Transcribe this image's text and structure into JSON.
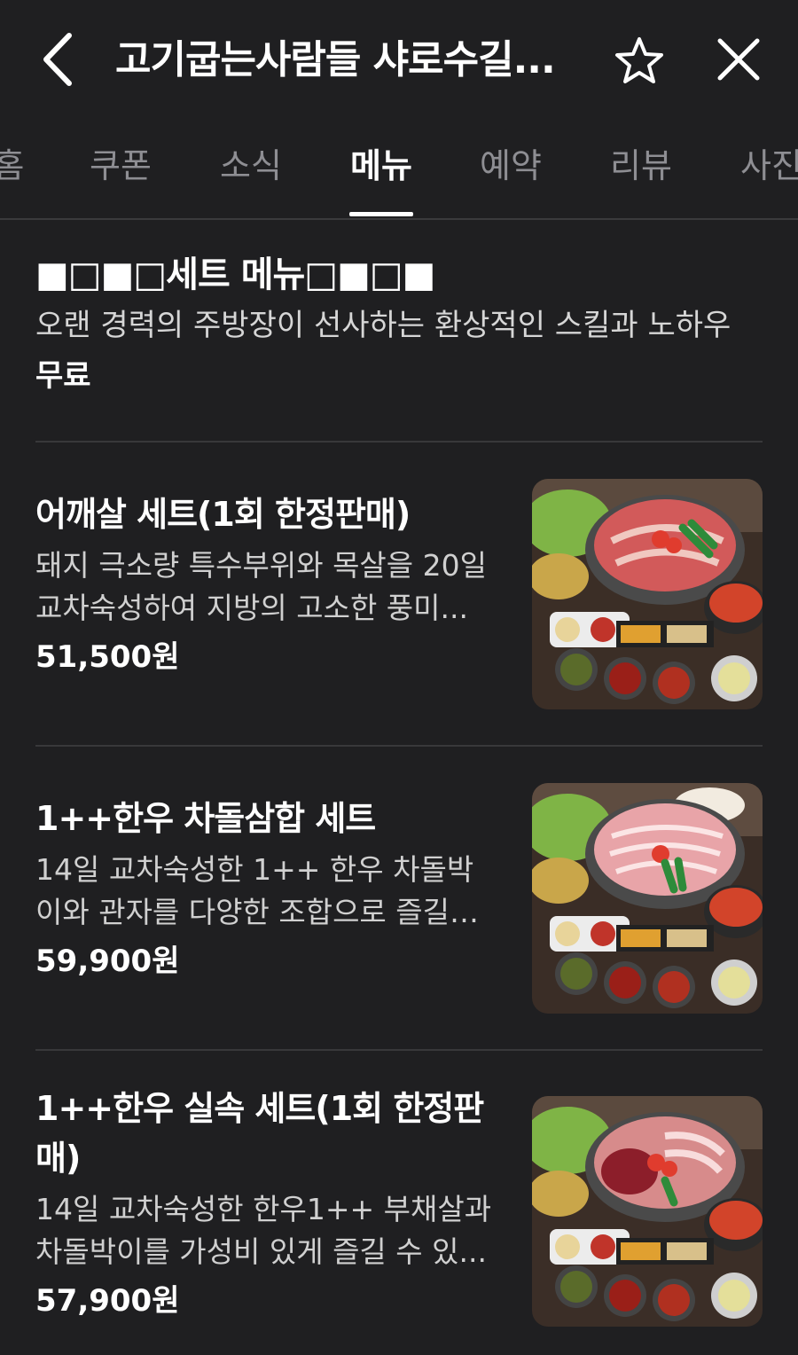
{
  "header": {
    "title": "고기굽는사람들 샤로수길...",
    "back_icon": "chevron-left-icon",
    "favorite_icon": "star-outline-icon",
    "close_icon": "close-icon"
  },
  "tabs": [
    {
      "label": "홈",
      "active": false
    },
    {
      "label": "쿠폰",
      "active": false
    },
    {
      "label": "소식",
      "active": false
    },
    {
      "label": "메뉴",
      "active": true
    },
    {
      "label": "예약",
      "active": false
    },
    {
      "label": "리뷰",
      "active": false
    },
    {
      "label": "사진",
      "active": false
    }
  ],
  "notice": {
    "title": "■□■□세트 메뉴□■□■",
    "description": "오랜 경력의 주방장이 선사하는 환상적인 스킬과 노하우",
    "price": "무료"
  },
  "menu_items": [
    {
      "name": "어깨살 세트(1회 한정판매)",
      "description": "돼지 극소량 특수부위와 목살을 20일 교차숙성하여 지방의 고소한 풍미...",
      "price": "51,500원",
      "photo": "korean-bbq-pork-set-photo"
    },
    {
      "name": "1++한우 차돌삼합 세트",
      "description": "14일 교차숙성한 1++ 한우 차돌박이와 관자를 다양한 조합으로 즐길 수...",
      "price": "59,900원",
      "photo": "korean-bbq-chadol-set-photo"
    },
    {
      "name": "1++한우 실속 세트(1회 한정판매)",
      "description": "14일 교차숙성한 한우1++ 부채살과 차돌박이를 가성비 있게 즐길 수 있...",
      "price": "57,900원",
      "photo": "korean-bbq-hanwoo-set-photo"
    }
  ],
  "colors": {
    "background": "#1f1f21",
    "text": "#ffffff",
    "muted": "#8e8e93",
    "divider": "#38383a"
  }
}
